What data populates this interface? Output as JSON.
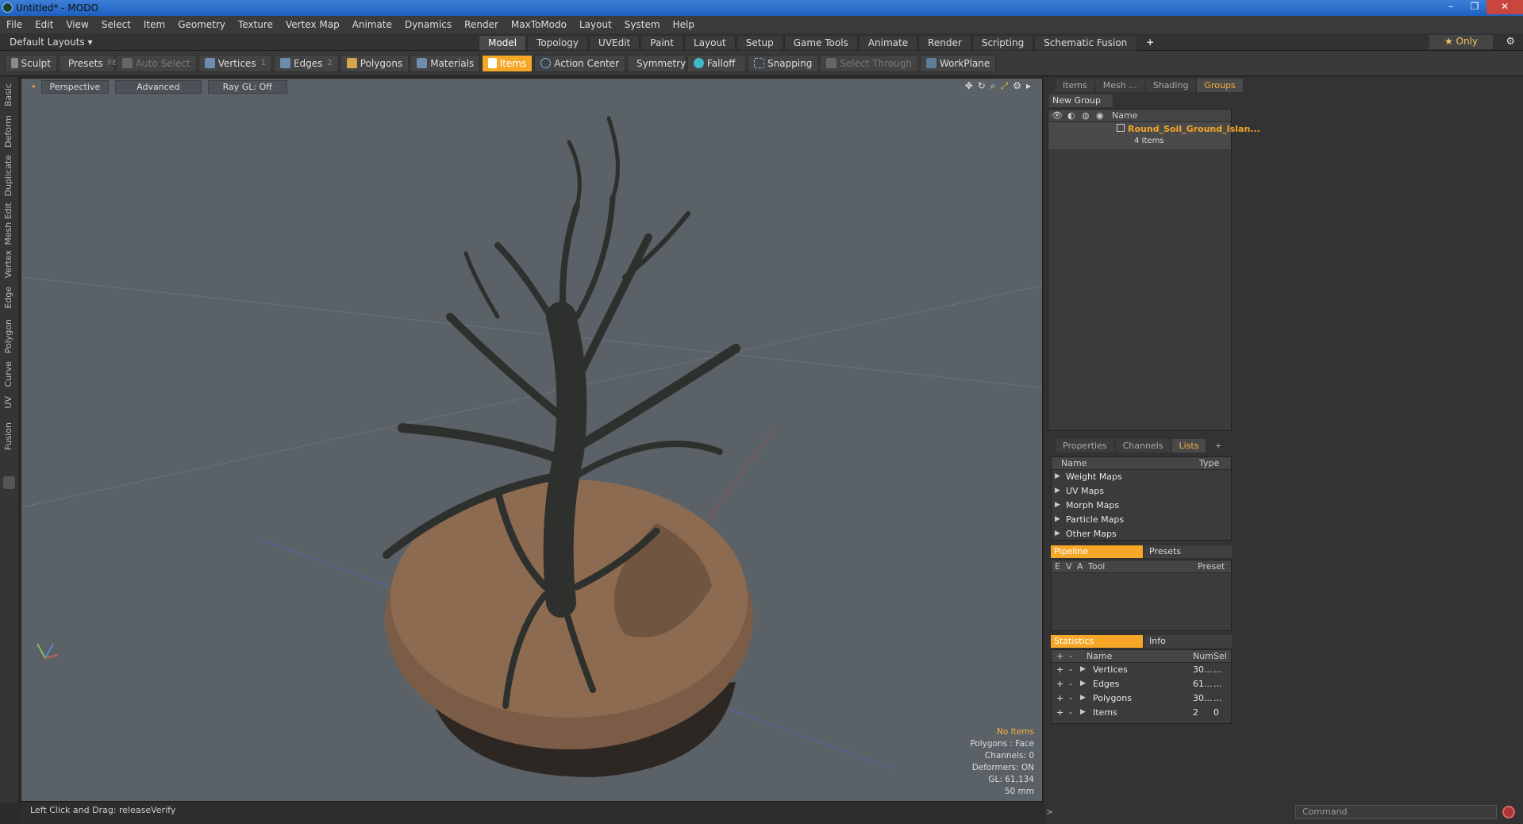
{
  "app": {
    "title": "Untitled* - MODO"
  },
  "menu": [
    "File",
    "Edit",
    "View",
    "Select",
    "Item",
    "Geometry",
    "Texture",
    "Vertex Map",
    "Animate",
    "Dynamics",
    "Render",
    "MaxToModo",
    "Layout",
    "System",
    "Help"
  ],
  "layouts": {
    "label": "Default Layouts ▾"
  },
  "tabs": [
    {
      "label": "Model",
      "active": true
    },
    {
      "label": "Topology"
    },
    {
      "label": "UVEdit"
    },
    {
      "label": "Paint"
    },
    {
      "label": "Layout"
    },
    {
      "label": "Setup"
    },
    {
      "label": "Game Tools"
    },
    {
      "label": "Animate"
    },
    {
      "label": "Render"
    },
    {
      "label": "Scripting"
    },
    {
      "label": "Schematic Fusion"
    },
    {
      "label": "+"
    }
  ],
  "only": {
    "label": "★  Only"
  },
  "toolbar": {
    "sculpt": "Sculpt",
    "presets": "Presets",
    "presets_key": "F6",
    "auto_select": "Auto Select",
    "vertices": "Vertices",
    "vertices_key": "1",
    "edges": "Edges",
    "edges_key": "2",
    "polygons": "Polygons",
    "materials": "Materials",
    "items": "Items",
    "action_center": "Action Center",
    "symmetry": "Symmetry",
    "falloff": "Falloff",
    "snapping": "Snapping",
    "select_through": "Select Through",
    "workplane": "WorkPlane"
  },
  "left_tabs": [
    "Basic",
    "Deform",
    "Duplicate",
    "Mesh Edit",
    "Vertex",
    "Edge",
    "Polygon",
    "Curve",
    "UV",
    "Fusion"
  ],
  "viewport": {
    "perspective": "Perspective",
    "advanced": "Advanced",
    "raygl": "Ray GL: Off",
    "info": {
      "no_items": "No Items",
      "polygons": "Polygons : Face",
      "channels": "Channels: 0",
      "deformers": "Deformers: ON",
      "gl": "GL: 61,134",
      "scale": "50 mm"
    }
  },
  "status": {
    "text": "Left Click and Drag:   releaseVerify"
  },
  "groups_panel": {
    "tabs": [
      {
        "label": "Items"
      },
      {
        "label": "Mesh ..."
      },
      {
        "label": "Shading"
      },
      {
        "label": "Groups",
        "active": true
      }
    ],
    "new_group": "New Group",
    "name_header": "Name",
    "group_name": "Round_Soil_Ground_Islan...",
    "group_count": "4 Items"
  },
  "lists_panel": {
    "tabs": [
      {
        "label": "Properties"
      },
      {
        "label": "Channels"
      },
      {
        "label": "Lists",
        "active": true
      },
      {
        "label": "+"
      }
    ],
    "name_header": "Name",
    "type_header": "Type",
    "items": [
      "Weight Maps",
      "UV Maps",
      "Morph Maps",
      "Particle Maps",
      "Other Maps"
    ]
  },
  "pipeline_panel": {
    "pipeline": "Pipeline",
    "presets": "Presets",
    "e": "E",
    "v": "V",
    "a": "A",
    "tool": "Tool",
    "preset": "Preset"
  },
  "statistics_panel": {
    "statistics": "Statistics",
    "info": "Info",
    "name_header": "Name",
    "num_header": "Num",
    "sel_header": "Sel",
    "rows": [
      {
        "name": "Vertices",
        "num": "30...",
        "sel": "..."
      },
      {
        "name": "Edges",
        "num": "61...",
        "sel": "..."
      },
      {
        "name": "Polygons",
        "num": "30...",
        "sel": "..."
      },
      {
        "name": "Items",
        "num": "2",
        "sel": "0"
      }
    ]
  },
  "command": {
    "placeholder": "Command"
  },
  "colors": {
    "accent": "#f6a727",
    "viewport_bg": "#5a6167",
    "panel_bg": "#333333"
  }
}
